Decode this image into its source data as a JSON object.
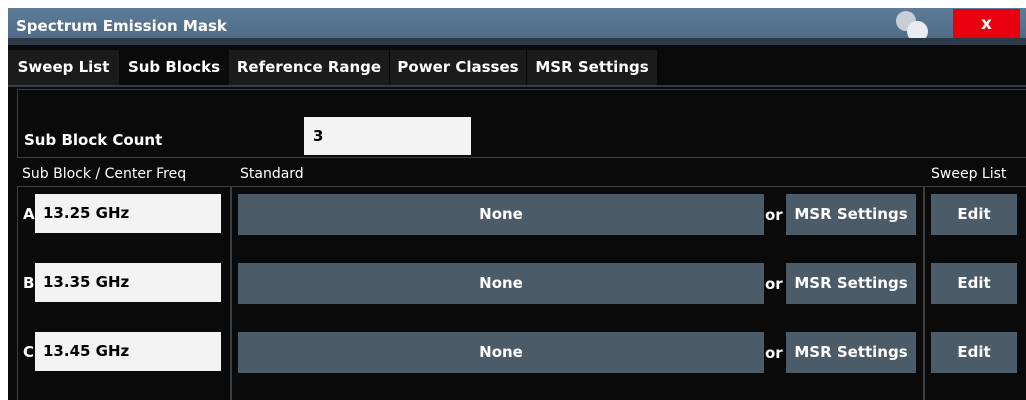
{
  "window": {
    "title": "Spectrum Emission Mask",
    "close_label": "x"
  },
  "tabs": [
    {
      "label": "Sweep List",
      "active": false
    },
    {
      "label": "Sub Blocks",
      "active": true
    },
    {
      "label": "Reference Range",
      "active": false
    },
    {
      "label": "Power Classes",
      "active": false
    },
    {
      "label": "MSR Settings",
      "active": false
    }
  ],
  "sub_block_count": {
    "label": "Sub Block Count",
    "value": "3"
  },
  "columns": {
    "center_freq": "Sub Block / Center Freq",
    "standard": "Standard",
    "sweep_list": "Sweep List"
  },
  "sub_blocks": [
    {
      "letter": "A",
      "center_freq": "13.25 GHz",
      "standard": "None",
      "or": "or",
      "msr_label": "MSR Settings",
      "edit_label": "Edit"
    },
    {
      "letter": "B",
      "center_freq": "13.35 GHz",
      "standard": "None",
      "or": "or",
      "msr_label": "MSR Settings",
      "edit_label": "Edit"
    },
    {
      "letter": "C",
      "center_freq": "13.45 GHz",
      "standard": "None",
      "or": "or",
      "msr_label": "MSR Settings",
      "edit_label": "Edit"
    }
  ],
  "colors": {
    "titlebar": "#516d89",
    "button": "#4c5b68",
    "close": "#e8000e",
    "background": "#0a0a0a"
  },
  "icons": {
    "logo": "rs-logo-icon",
    "close": "close-icon"
  }
}
